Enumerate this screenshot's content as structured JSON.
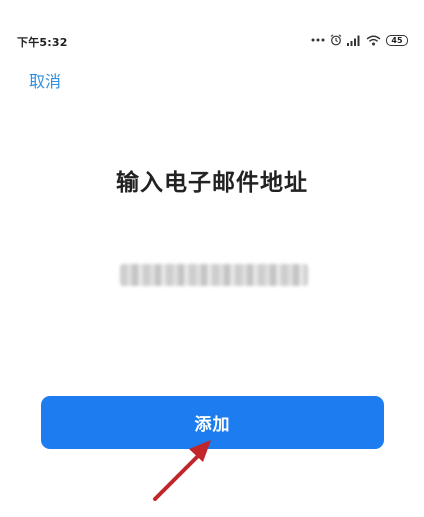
{
  "status_bar": {
    "time": "下午5:32",
    "icons": [
      "more-dots-icon",
      "alarm-icon",
      "signal-icon",
      "wifi-icon",
      "battery-icon"
    ],
    "battery_level": "45"
  },
  "header": {
    "cancel_label": "取消"
  },
  "main": {
    "title": "输入电子邮件地址",
    "email_value": ""
  },
  "actions": {
    "add_label": "添加"
  },
  "colors": {
    "accent": "#1c7cf0",
    "link": "#2f8fe0",
    "annotation": "#c0262b"
  }
}
